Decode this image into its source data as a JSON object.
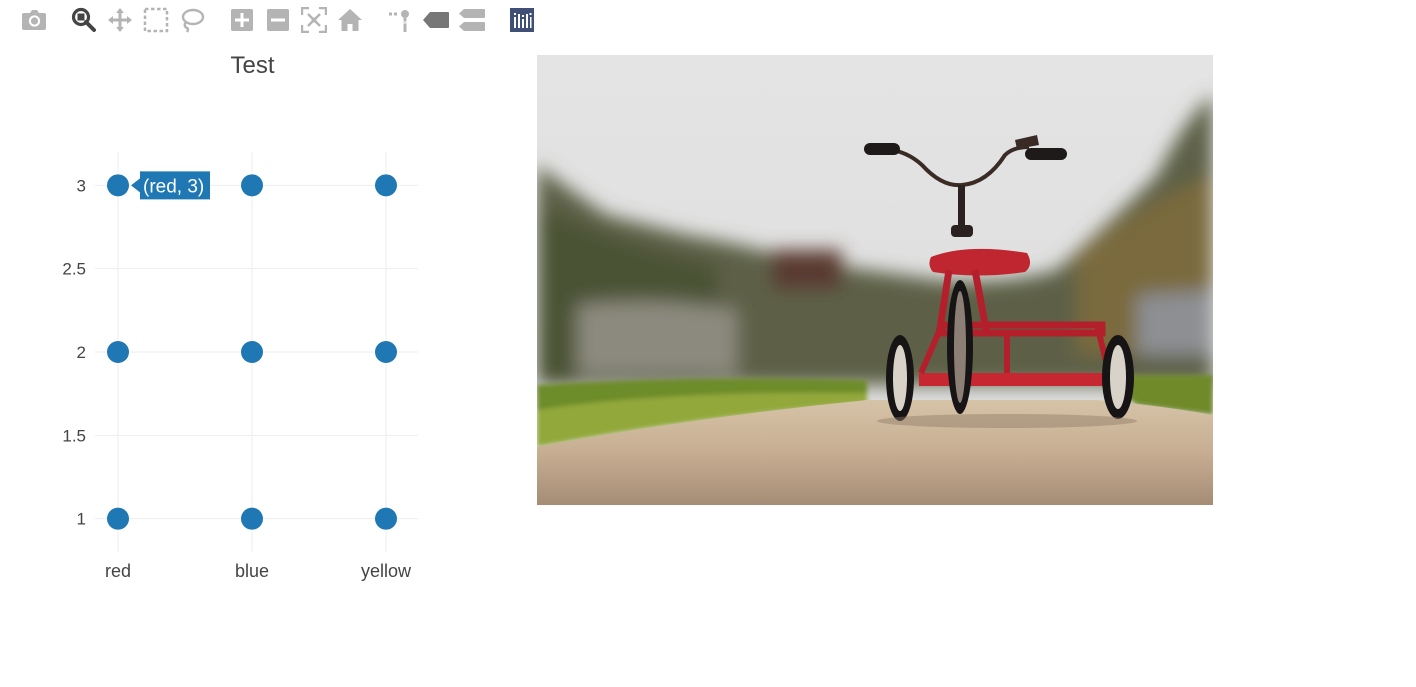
{
  "modebar": {
    "buttons": [
      {
        "name": "camera-icon",
        "label": "Download plot as a png"
      },
      {
        "name": "zoom-icon",
        "label": "Zoom"
      },
      {
        "name": "pan-icon",
        "label": "Pan"
      },
      {
        "name": "box-select-icon",
        "label": "Box Select"
      },
      {
        "name": "lasso-select-icon",
        "label": "Lasso Select"
      },
      {
        "name": "zoom-in-icon",
        "label": "Zoom in"
      },
      {
        "name": "zoom-out-icon",
        "label": "Zoom out"
      },
      {
        "name": "autoscale-icon",
        "label": "Autoscale"
      },
      {
        "name": "reset-axes-icon",
        "label": "Reset axes"
      },
      {
        "name": "spike-lines-icon",
        "label": "Toggle Spike Lines"
      },
      {
        "name": "hover-closest-icon",
        "label": "Show closest data on hover"
      },
      {
        "name": "hover-compare-icon",
        "label": "Compare data on hover"
      },
      {
        "name": "plotly-logo-icon",
        "label": "Produced with Plotly"
      }
    ],
    "active": "zoom-icon",
    "colors": {
      "icon": "#b4b4b4",
      "active": "#444444",
      "logo": "#3f4f75"
    }
  },
  "chart_data": {
    "type": "scatter",
    "title": "Test",
    "categories": [
      "red",
      "blue",
      "yellow"
    ],
    "y_ticks": [
      "1",
      "1.5",
      "2",
      "2.5",
      "3"
    ],
    "ylim": [
      0.8,
      3.2
    ],
    "grid": true,
    "series": [
      {
        "color": "#1f77b4",
        "points": [
          {
            "x": "red",
            "y": 1
          },
          {
            "x": "red",
            "y": 2
          },
          {
            "x": "red",
            "y": 3
          },
          {
            "x": "blue",
            "y": 1
          },
          {
            "x": "blue",
            "y": 2
          },
          {
            "x": "blue",
            "y": 3
          },
          {
            "x": "yellow",
            "y": 1
          },
          {
            "x": "yellow",
            "y": 2
          },
          {
            "x": "yellow",
            "y": 3
          }
        ]
      }
    ],
    "hover": {
      "x": "red",
      "y": 3,
      "label": "(red, 3)"
    }
  },
  "image": {
    "name": "tricycle-photo",
    "colors": {
      "sky": "#e3e3e3",
      "frame": "#c0262f",
      "grass": "#6e8a2c",
      "path": "#c6b095"
    }
  }
}
